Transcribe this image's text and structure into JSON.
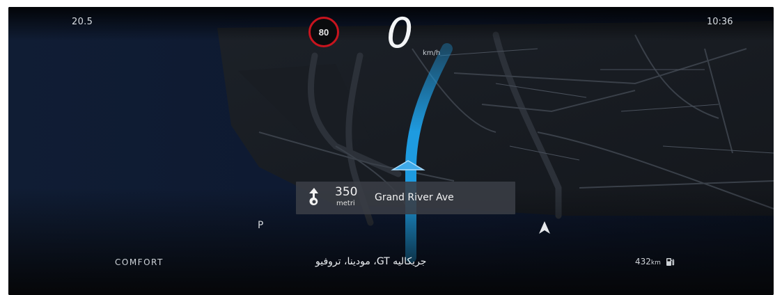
{
  "odometer": "20.5",
  "clock": "10:36",
  "speed_limit": "80",
  "speed": {
    "value": "0",
    "unit": "km/h"
  },
  "navigation": {
    "distance": "350",
    "distance_unit": "metri",
    "street": "Grand River Ave",
    "maneuver_icon": "turn-arrow-icon"
  },
  "gear": "P",
  "drive_mode": "COMFORT",
  "location": "جريكاليه GT، مودينا، تروفيو",
  "range": {
    "value": "432",
    "unit": "km",
    "icon": "fuel-pump-icon"
  },
  "colors": {
    "route": "#1e9be0",
    "speed_limit_ring": "#c8141e",
    "background": "#050608",
    "card": "#3a3e46"
  }
}
